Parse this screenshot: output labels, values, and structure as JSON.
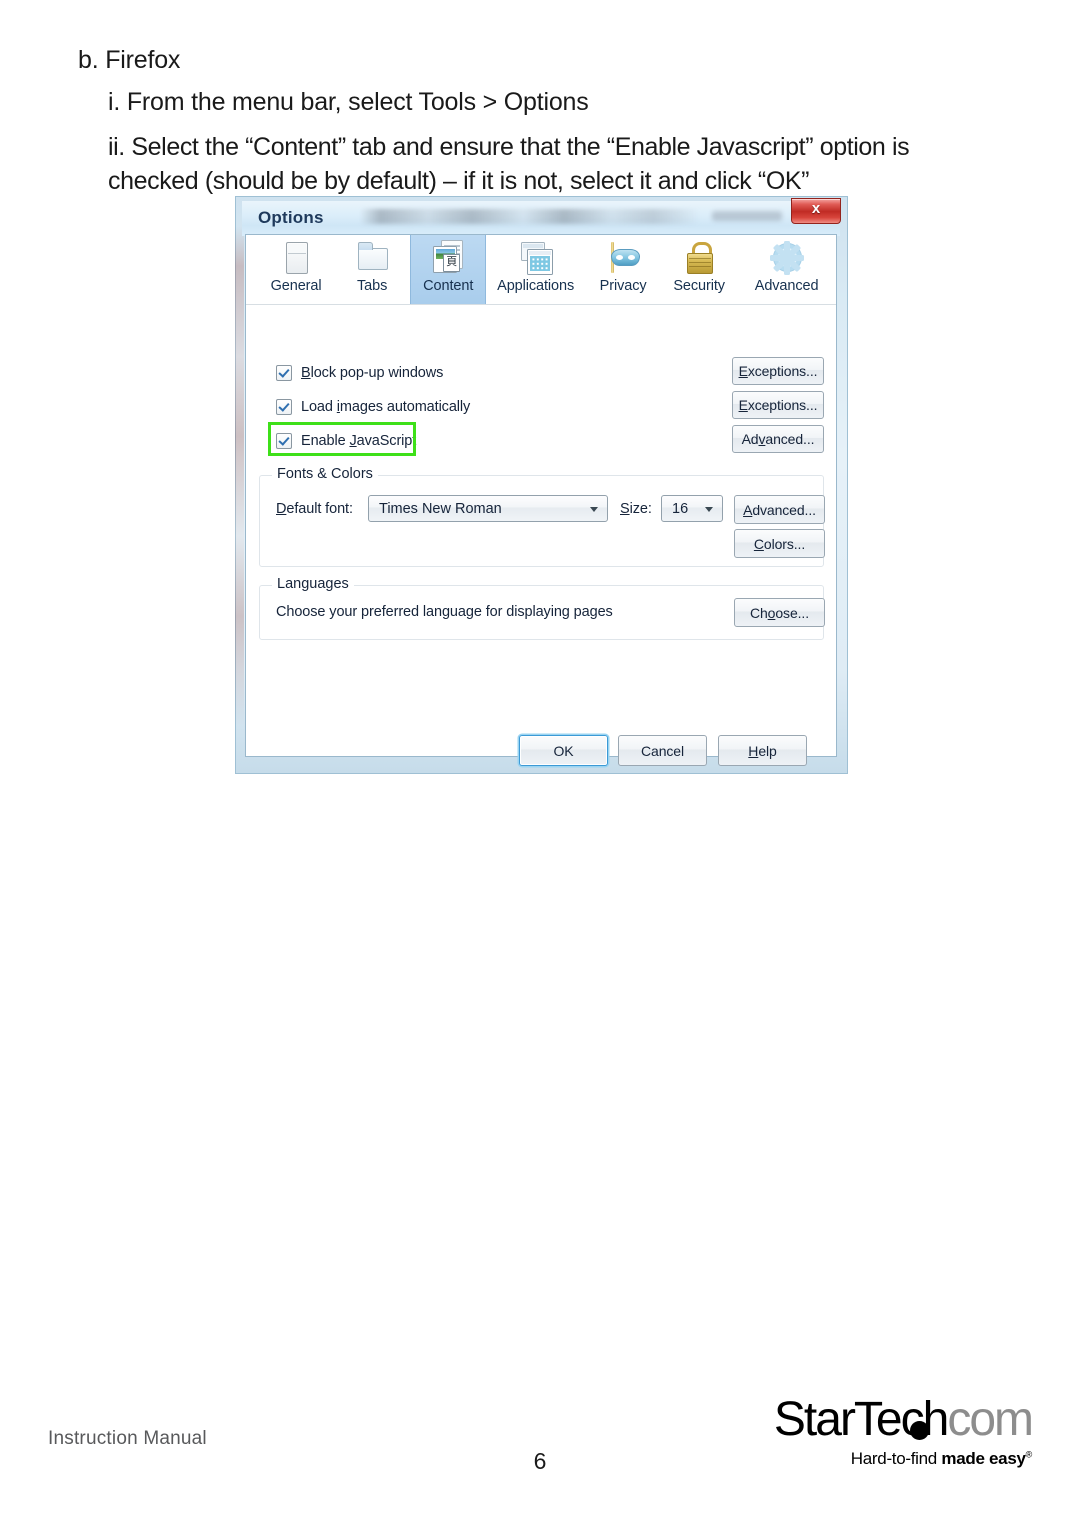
{
  "document": {
    "heading": "b. Firefox",
    "step_i": "i. From the menu bar, select Tools > Options",
    "step_ii_line1": "ii. Select the “Content” tab and ensure that the “Enable Javascript” option is",
    "step_ii_line2": "checked (should be by default) – if it is not, select it and click “OK”"
  },
  "dialog": {
    "title": "Options",
    "close_label": "x",
    "tabs": [
      {
        "label": "General",
        "icon": "browser-window-icon",
        "selected": false
      },
      {
        "label": "Tabs",
        "icon": "tabs-icon",
        "selected": false
      },
      {
        "label": "Content",
        "icon": "content-page-icon",
        "selected": true
      },
      {
        "label": "Applications",
        "icon": "applications-icon",
        "selected": false
      },
      {
        "label": "Privacy",
        "icon": "privacy-mask-icon",
        "selected": false
      },
      {
        "label": "Security",
        "icon": "padlock-icon",
        "selected": false
      },
      {
        "label": "Advanced",
        "icon": "gear-icon",
        "selected": false
      }
    ],
    "checkboxes": [
      {
        "label": "Block pop-up windows",
        "checked": true,
        "button": "Exceptions...",
        "highlighted": false
      },
      {
        "label": "Load images automatically",
        "checked": true,
        "button": "Exceptions...",
        "highlighted": false
      },
      {
        "label": "Enable JavaScript",
        "checked": true,
        "button": "Advanced...",
        "highlighted": true
      }
    ],
    "fonts_group": {
      "title": "Fonts & Colors",
      "font_label": "Default font:",
      "font_value": "Times New Roman",
      "size_label": "Size:",
      "size_value": "16",
      "advanced_button": "Advanced...",
      "colors_button": "Colors..."
    },
    "languages_group": {
      "title": "Languages",
      "description": "Choose your preferred language for displaying pages",
      "choose_button": "Choose..."
    },
    "actions": {
      "ok": "OK",
      "cancel": "Cancel",
      "help": "Help"
    },
    "highlight_color": "#3ee019"
  },
  "footer": {
    "manual_label": "Instruction Manual",
    "page_number": "6",
    "logo_star": "StarTech",
    "logo_com": "com",
    "logo_tagline_plain": "Hard-to-find ",
    "logo_tagline_bold": "made easy",
    "logo_tagline_mark": "®"
  }
}
